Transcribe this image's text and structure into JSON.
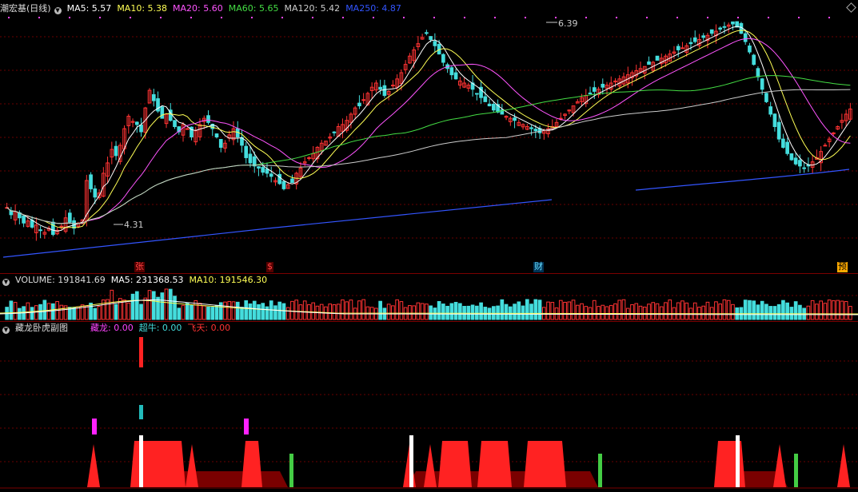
{
  "price_panel": {
    "title": "潮宏基(日线)",
    "ma": [
      {
        "label": "MA5: 5.57",
        "color": "#ffffff"
      },
      {
        "label": "MA10: 5.38",
        "color": "#ffff55"
      },
      {
        "label": "MA20: 5.60",
        "color": "#ff55ff"
      },
      {
        "label": "MA60: 5.65",
        "color": "#44dd44"
      },
      {
        "label": "MA120: 5.42",
        "color": "#cccccc"
      },
      {
        "label": "MA250: 4.87",
        "color": "#3355ff"
      }
    ],
    "high_label": "6.39",
    "low_label": "4.31",
    "markers": [
      {
        "text": "张",
        "color": "#ff4444",
        "bg": "#550000"
      },
      {
        "text": "$",
        "color": "#ff4444",
        "bg": "#550000"
      },
      {
        "text": "财",
        "color": "#66ddff",
        "bg": "#003355"
      },
      {
        "text": "预",
        "color": "#000000",
        "bg": "#ffaa00"
      }
    ]
  },
  "volume_panel": {
    "label": "VOLUME: 191841.69",
    "ma5": "MA5: 231368.53",
    "ma10": "MA10: 191546.30"
  },
  "indicator_panel": {
    "title": "藏龙卧虎副图",
    "items": [
      {
        "label": "藏龙: 0.00",
        "color": "#ff44ff"
      },
      {
        "label": "超牛: 0.00",
        "color": "#44dddd"
      },
      {
        "label": "飞天: 0.00",
        "color": "#ff3333"
      }
    ]
  },
  "chart_data": {
    "type": "candlestick",
    "price_range": [
      4.31,
      6.39
    ],
    "closes": [
      4.62,
      4.55,
      4.58,
      4.52,
      4.47,
      4.49,
      4.43,
      4.45,
      4.4,
      4.38,
      4.42,
      4.36,
      4.4,
      4.44,
      4.52,
      4.48,
      4.42,
      4.47,
      4.5,
      4.88,
      4.8,
      4.72,
      4.76,
      4.95,
      5.05,
      5.18,
      5.12,
      5.22,
      5.38,
      5.5,
      5.45,
      5.42,
      5.35,
      5.58,
      5.75,
      5.65,
      5.55,
      5.48,
      5.52,
      5.46,
      5.4,
      5.35,
      5.42,
      5.38,
      5.3,
      5.36,
      5.42,
      5.48,
      5.44,
      5.38,
      5.3,
      5.2,
      5.24,
      5.32,
      5.38,
      5.3,
      5.22,
      5.1,
      5.05,
      5.02,
      5.0,
      4.96,
      4.95,
      4.92,
      4.88,
      4.85,
      4.8,
      4.84,
      4.86,
      4.95,
      5.0,
      5.06,
      5.1,
      5.14,
      5.2,
      5.24,
      5.26,
      5.3,
      5.34,
      5.4,
      5.42,
      5.46,
      5.52,
      5.58,
      5.6,
      5.66,
      5.72,
      5.78,
      5.82,
      5.76,
      5.7,
      5.74,
      5.8,
      5.86,
      5.92,
      6.0,
      6.08,
      6.14,
      6.2,
      6.26,
      6.3,
      6.24,
      6.18,
      6.1,
      6.02,
      5.96,
      5.9,
      5.86,
      5.84,
      5.82,
      5.8,
      5.76,
      5.72,
      5.68,
      5.64,
      5.6,
      5.56,
      5.54,
      5.52,
      5.5,
      5.48,
      5.46,
      5.44,
      5.42,
      5.4,
      5.38,
      5.36,
      5.34,
      5.36,
      5.38,
      5.4,
      5.44,
      5.48,
      5.52,
      5.56,
      5.6,
      5.64,
      5.68,
      5.7,
      5.72,
      5.74,
      5.76,
      5.78,
      5.8,
      5.82,
      5.84,
      5.86,
      5.88,
      5.9,
      5.92,
      5.94,
      5.96,
      5.98,
      6.0,
      6.02,
      6.04,
      6.06,
      6.08,
      6.1,
      6.12,
      6.14,
      6.16,
      6.18,
      6.2,
      6.22,
      6.24,
      6.26,
      6.28,
      6.3,
      6.32,
      6.34,
      6.36,
      6.38,
      6.39,
      6.36,
      6.3,
      6.22,
      6.12,
      6.0,
      5.88,
      5.76,
      5.64,
      5.52,
      5.4,
      5.28,
      5.2,
      5.14,
      5.08,
      5.04,
      5.02,
      5.0,
      5.02,
      5.06,
      5.1,
      5.16,
      5.22,
      5.28,
      5.34,
      5.4,
      5.46,
      5.52,
      5.57
    ],
    "volume_range": [
      0,
      350000
    ]
  }
}
